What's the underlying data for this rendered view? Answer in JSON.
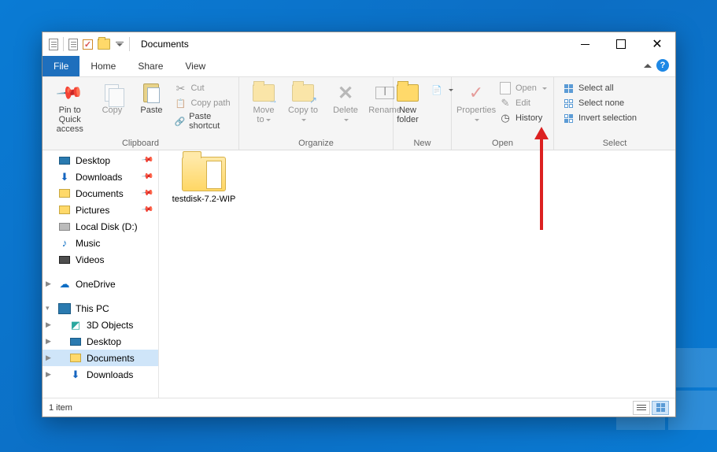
{
  "window": {
    "title": "Documents"
  },
  "tabs": {
    "file": "File",
    "home": "Home",
    "share": "Share",
    "view": "View"
  },
  "ribbon": {
    "clipboard": {
      "label": "Clipboard",
      "pin": "Pin to Quick access",
      "copy": "Copy",
      "paste": "Paste",
      "cut": "Cut",
      "copy_path": "Copy path",
      "paste_shortcut": "Paste shortcut"
    },
    "organize": {
      "label": "Organize",
      "move_to": "Move to",
      "copy_to": "Copy to",
      "delete": "Delete",
      "rename": "Rename"
    },
    "new": {
      "label": "New",
      "new_folder": "New folder"
    },
    "open": {
      "label": "Open",
      "properties": "Properties",
      "open": "Open",
      "edit": "Edit",
      "history": "History"
    },
    "select": {
      "label": "Select",
      "all": "Select all",
      "none": "Select none",
      "invert": "Invert selection"
    }
  },
  "nav": {
    "quick": [
      {
        "label": "Desktop",
        "icon": "monitor",
        "pinned": true
      },
      {
        "label": "Downloads",
        "icon": "download",
        "pinned": true
      },
      {
        "label": "Documents",
        "icon": "folder",
        "pinned": true
      },
      {
        "label": "Pictures",
        "icon": "folder",
        "pinned": true
      },
      {
        "label": "Local Disk (D:)",
        "icon": "disk",
        "pinned": false
      },
      {
        "label": "Music",
        "icon": "music",
        "pinned": false
      },
      {
        "label": "Videos",
        "icon": "video",
        "pinned": false
      }
    ],
    "onedrive": "OneDrive",
    "thispc": "This PC",
    "pc_children": [
      {
        "label": "3D Objects",
        "icon": "cube"
      },
      {
        "label": "Desktop",
        "icon": "monitor"
      },
      {
        "label": "Documents",
        "icon": "folder",
        "selected": true
      },
      {
        "label": "Downloads",
        "icon": "download"
      }
    ]
  },
  "files": [
    {
      "name": "testdisk-7.2-WIP"
    }
  ],
  "status": {
    "count": "1 item"
  }
}
